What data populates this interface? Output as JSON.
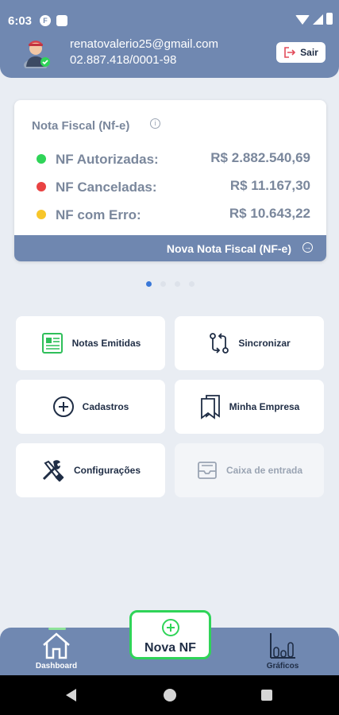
{
  "status_bar": {
    "time": "6:03"
  },
  "user": {
    "email": "renatovalerio25@gmail.com",
    "document": "02.887.418/0001-98",
    "logout_label": "Sair"
  },
  "summary_card": {
    "title": "Nota Fiscal (Nf-e)",
    "rows": [
      {
        "label": "NF Autorizadas:",
        "value": "R$ 2.882.540,69",
        "color": "#2fd458"
      },
      {
        "label": "NF Canceladas:",
        "value": "R$ 11.167,30",
        "color": "#e94242"
      },
      {
        "label": "NF com Erro:",
        "value": "R$ 10.643,22",
        "color": "#f7c62a"
      }
    ],
    "action_label": "Nova Nota Fiscal (NF-e)"
  },
  "pager": {
    "count": 4,
    "active": 1
  },
  "tiles": [
    {
      "label": "Notas Emitidas",
      "icon": "document-list-icon",
      "enabled": true
    },
    {
      "label": "Sincronizar",
      "icon": "sync-icon",
      "enabled": true
    },
    {
      "label": "Cadastros",
      "icon": "plus-circle-icon",
      "enabled": true
    },
    {
      "label": "Minha Empresa",
      "icon": "bookmarks-icon",
      "enabled": true
    },
    {
      "label": "Configurações",
      "icon": "tools-icon",
      "enabled": true
    },
    {
      "label": "Caixa de entrada",
      "icon": "inbox-icon",
      "enabled": false
    }
  ],
  "bottom_nav": {
    "dashboard_label": "Dashboard",
    "new_nf_label": "Nova NF",
    "charts_label": "Gráficos"
  },
  "colors": {
    "header": "#7088b1",
    "accent_green": "#2fd458",
    "background": "#e9edf3",
    "pager_active": "#3a78d8"
  }
}
